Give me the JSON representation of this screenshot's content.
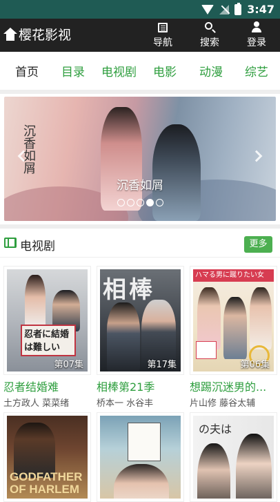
{
  "status_bar": {
    "time": "3:47",
    "icons": [
      "wifi-icon",
      "signal-off-icon",
      "battery-charging-icon"
    ]
  },
  "app_bar": {
    "title": "樱花影视",
    "home_icon": "home-icon",
    "actions": [
      {
        "label": "导航",
        "icon": "list-icon"
      },
      {
        "label": "搜索",
        "icon": "search-icon"
      },
      {
        "label": "登录",
        "icon": "user-icon"
      }
    ]
  },
  "categories": [
    {
      "label": "首页",
      "active": true
    },
    {
      "label": "目录",
      "active": false
    },
    {
      "label": "电视剧",
      "active": false
    },
    {
      "label": "电影",
      "active": false
    },
    {
      "label": "动漫",
      "active": false
    },
    {
      "label": "综艺",
      "active": false
    }
  ],
  "banner": {
    "caption": "沉香如屑",
    "poster_calligraphy": "沉香如屑",
    "slide_count": 5,
    "active_slide": 4
  },
  "section": {
    "title": "电视剧",
    "more_label": "更多",
    "icon": "film-icon"
  },
  "cards": [
    {
      "title": "忍者结婚难",
      "cast": "土方政人 菜菜绪",
      "episode": "第07集",
      "poster_text": "忍者に結婚は難しい"
    },
    {
      "title": "相棒第21季",
      "cast": "桥本一 水谷丰",
      "episode": "第17集",
      "poster_text": "相棒"
    },
    {
      "title": "想踢沉迷男的...",
      "cast": "片山修 藤谷太辅",
      "episode": "第06集",
      "poster_text": "ハマる男に蹴りたい女"
    },
    {
      "poster_text": "GODFATHER OF HARLEM"
    },
    {
      "poster_text": ""
    },
    {
      "poster_text": "の夫は"
    }
  ],
  "colors": {
    "status_bar": "#1f5b54",
    "app_bar": "#222222",
    "accent_green": "#2e9e3e",
    "more_button": "#4caf50"
  }
}
